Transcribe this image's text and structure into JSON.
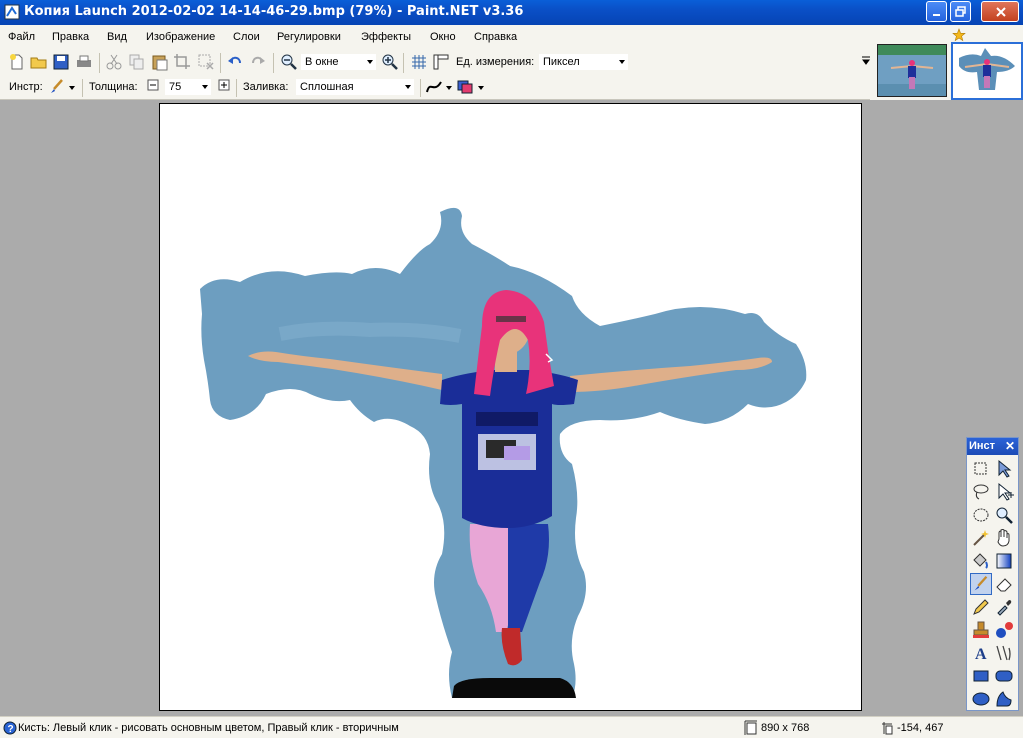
{
  "window": {
    "title": "Копия Launch 2012-02-02 14-14-46-29.bmp (79%) - Paint.NET v3.36"
  },
  "menu": [
    "Файл",
    "Правка",
    "Вид",
    "Изображение",
    "Слои",
    "Регулировки",
    "Эффекты",
    "Окно",
    "Справка"
  ],
  "toolbar": {
    "zoom_value": "В окне",
    "units_label": "Ед. измерения:",
    "units_value": "Пиксел"
  },
  "tool_options": {
    "tool_label": "Инстр:",
    "width_label": "Толщина:",
    "width_value": "75",
    "fill_label": "Заливка:",
    "fill_value": "Сплошная"
  },
  "tools_window": {
    "title": "Инст",
    "close": "✕"
  },
  "status": {
    "hint": "Кисть: Левый клик - рисовать основным цветом, Правый клик - вторичным",
    "image_size": "890 x 768",
    "cursor_pos": "-154, 467"
  },
  "colors": {
    "titlebar": "#0a4fc6",
    "workspace": "#ababab",
    "sky": "#6d9ec0",
    "hair": "#e8337a",
    "shirt": "#1a2d98"
  }
}
